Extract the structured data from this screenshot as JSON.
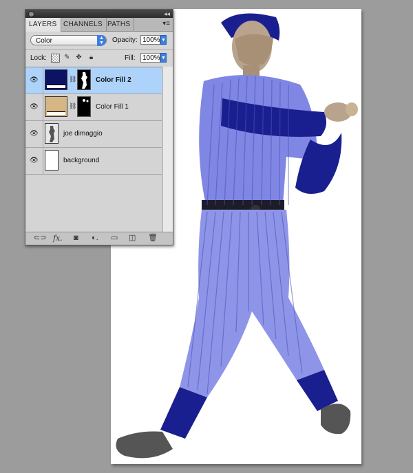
{
  "panel": {
    "tabs": [
      "LAYERS",
      "CHANNELS",
      "PATHS"
    ],
    "blend_mode": "Color",
    "opacity_label": "Opacity:",
    "opacity_value": "100%",
    "lock_label": "Lock:",
    "fill_label": "Fill:",
    "fill_value": "100%"
  },
  "layers": [
    {
      "name": "Color Fill 2",
      "selected": true,
      "thumb_color": "#0c1362",
      "has_mask": true
    },
    {
      "name": "Color Fill 1",
      "selected": false,
      "thumb_color": "#d6b685",
      "has_mask": true
    },
    {
      "name": "joe dimaggio",
      "selected": false,
      "thumb_color": "#cfcfcf",
      "has_mask": false
    },
    {
      "name": "background",
      "selected": false,
      "thumb_color": "#ffffff",
      "has_mask": false
    }
  ],
  "bottom_icons": [
    "link-layers-icon",
    "fx-icon",
    "add-mask-icon",
    "adjustment-layer-icon",
    "new-group-icon",
    "new-layer-icon",
    "trash-icon"
  ],
  "colors": {
    "uniform": "#7f86e3",
    "navy": "#1a1f8f",
    "selection": "#aed3fb"
  }
}
